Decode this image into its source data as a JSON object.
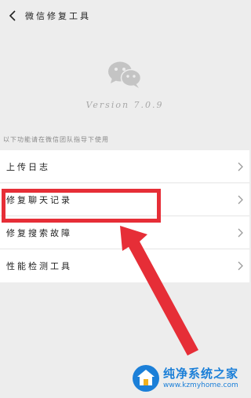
{
  "header": {
    "title": "微信修复工具"
  },
  "app": {
    "version": "Version 7.0.9"
  },
  "hint": "以下功能请在微信团队指导下使用",
  "menu": {
    "items": [
      {
        "label": "上传日志"
      },
      {
        "label": "修复聊天记录"
      },
      {
        "label": "修复搜索故障"
      },
      {
        "label": "性能检测工具"
      }
    ]
  },
  "icons": {
    "back": "chevron-left-icon",
    "logo": "wechat-logo-icon",
    "chevron": "chevron-right-icon"
  },
  "colors": {
    "background": "#ededed",
    "highlight": "#e62e37",
    "watermark": "#1b7fd8"
  },
  "watermark": {
    "name": "纯净系统之家",
    "url": "www.kzmyhome.com"
  }
}
